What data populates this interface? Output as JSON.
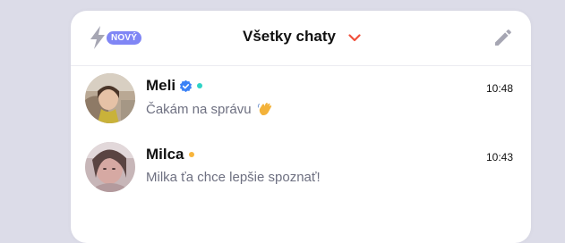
{
  "colors": {
    "background": "#dcdce8",
    "panel": "#ffffff",
    "badge": "#8086f5",
    "chevron": "#f0503c",
    "icon_gray": "#a6a6b3",
    "verified": "#3b82f6",
    "online_dot": "#2ed3c6",
    "away_dot": "#f8b53c",
    "text_primary": "#111111",
    "text_secondary": "#6e7081"
  },
  "header": {
    "left_icon": "lightning-icon",
    "badge": "NOVÝ",
    "title": "Všetky chaty",
    "dropdown_icon": "chevron-down-icon",
    "right_icon": "pencil-icon"
  },
  "chats": [
    {
      "name": "Meli",
      "verified": true,
      "status": "online",
      "time": "10:48",
      "message": "Čakám na správu",
      "message_emoji": "waving-hand-icon"
    },
    {
      "name": "Milca",
      "verified": false,
      "status": "away",
      "time": "10:43",
      "message": "Milka ťa chce lepšie spoznať!"
    }
  ]
}
